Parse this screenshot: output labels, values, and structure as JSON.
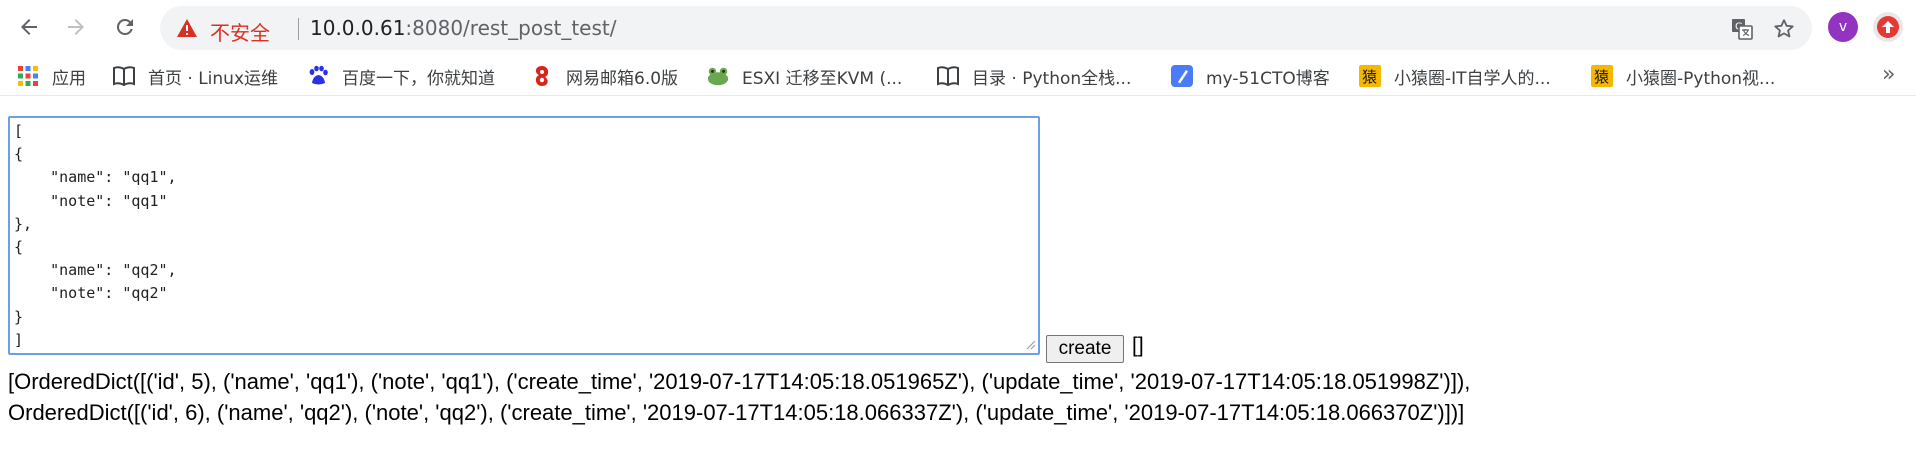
{
  "browser": {
    "security_label": "不安全",
    "url_host": "10.0.0.61",
    "url_rest": ":8080/rest_post_test/",
    "avatar_letter": "v",
    "icons": {
      "back": "back-arrow-icon",
      "forward": "forward-arrow-icon",
      "reload": "reload-icon",
      "warning": "warning-triangle-icon",
      "translate": "translate-icon",
      "bookmark_star": "star-icon",
      "extension": "upload-arrow-icon"
    },
    "colors": {
      "security": "#d93025",
      "avatar": "#9334c0",
      "extension": "#e53935"
    }
  },
  "bookmarks": [
    {
      "label": "应用",
      "icon": "apps-grid-icon"
    },
    {
      "label": "首页 · Linux运维",
      "icon": "book-icon"
    },
    {
      "label": "百度一下，你就知道",
      "icon": "baidu-paw-icon"
    },
    {
      "label": "网易邮箱6.0版",
      "icon": "netease-mail-icon"
    },
    {
      "label": "ESXI 迁移至KVM (...",
      "icon": "frog-icon"
    },
    {
      "label": "目录 · Python全栈...",
      "icon": "book-icon"
    },
    {
      "label": "my-51CTO博客",
      "icon": "pen-icon"
    },
    {
      "label": "小猿圈-IT自学人的...",
      "icon": "ape-logo-icon"
    },
    {
      "label": "小猿圈-Python视...",
      "icon": "ape-logo-icon"
    }
  ],
  "bookmarks_overflow": "»",
  "page": {
    "textarea_value": "[\n{\n    \"name\": \"qq1\",\n    \"note\": \"qq1\"\n},\n{\n    \"name\": \"qq2\",\n    \"note\": \"qq2\"\n}\n]",
    "create_label": "create",
    "empty_result": "[]",
    "result_line1": "[OrderedDict([('id', 5), ('name', 'qq1'), ('note', 'qq1'), ('create_time', '2019-07-17T14:05:18.051965Z'), ('update_time', '2019-07-17T14:05:18.051998Z')]),",
    "result_line2": "OrderedDict([('id', 6), ('name', 'qq2'), ('note', 'qq2'), ('create_time', '2019-07-17T14:05:18.066337Z'), ('update_time', '2019-07-17T14:05:18.066370Z')])]"
  }
}
